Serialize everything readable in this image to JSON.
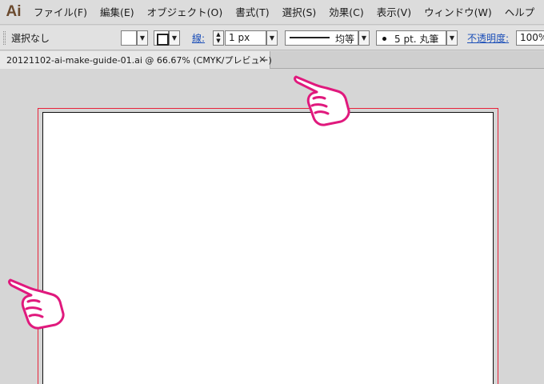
{
  "app": {
    "logo": "Ai"
  },
  "menubar": {
    "items": [
      "ファイル(F)",
      "編集(E)",
      "オブジェクト(O)",
      "書式(T)",
      "選択(S)",
      "効果(C)",
      "表示(V)",
      "ウィンドウ(W)",
      "ヘルプ"
    ]
  },
  "controlbar": {
    "selection_status": "選択なし",
    "stroke_label": "線",
    "stroke_weight": "1 px",
    "profile": "均等",
    "brush": "5 pt. 丸筆",
    "opacity_label": "不透明度",
    "opacity_value": "100%"
  },
  "document": {
    "tab_title": "20121102-ai-make-guide-01.ai @ 66.67% (CMYK/プレビュー)",
    "close_glyph": "×"
  },
  "colors": {
    "logo": "#6b4a2e",
    "bleed_guide": "#e8223a",
    "pointer_hand": "#e0197d"
  },
  "icons": [
    "fill-swatch",
    "stroke-swatch-icon",
    "pointing-hand-icon"
  ]
}
